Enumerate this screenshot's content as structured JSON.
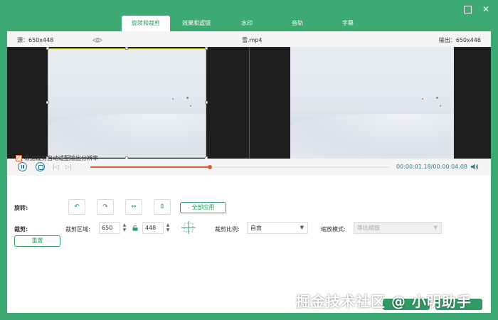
{
  "window": {
    "tabs": [
      {
        "label": "旋转和裁剪",
        "active": true
      },
      {
        "label": "效果和滤镜",
        "active": false
      },
      {
        "label": "水印",
        "active": false
      },
      {
        "label": "音轨",
        "active": false
      },
      {
        "label": "字幕",
        "active": false
      }
    ]
  },
  "preview": {
    "source_label": "源：650x448",
    "file_name": "雪.mp4",
    "output_label": "输出：650x448"
  },
  "playback": {
    "progress": 0.4,
    "time": "00:00:01.18/00:00:04.08"
  },
  "options": {
    "auto_fit_label": "根据裁剪自动适配输出分辨率",
    "auto_fit_checked": true,
    "rotate_label": "旋转:",
    "rotate_buttons": [
      {
        "glyph": "↶",
        "name": "rotate-left"
      },
      {
        "glyph": "↷",
        "name": "rotate-right"
      },
      {
        "glyph": "⇔",
        "name": "flip-horizontal"
      },
      {
        "glyph": "⇕",
        "name": "flip-vertical"
      }
    ],
    "apply_all_label": "全部应用",
    "crop_label": "裁剪:",
    "crop_area_label": "裁剪区域:",
    "crop_width": "650",
    "crop_height": "448",
    "ratio_label": "裁剪比例:",
    "ratio_value": "自由",
    "zoom_label": "缩放模式:",
    "zoom_value": "等比缩放",
    "reset_label": "重置"
  },
  "watermark": "掘金技术社区 @ 小明助手",
  "colors": {
    "brand": "#3daa73",
    "accent": "#2f9a63",
    "progress": "#e05a2b"
  }
}
